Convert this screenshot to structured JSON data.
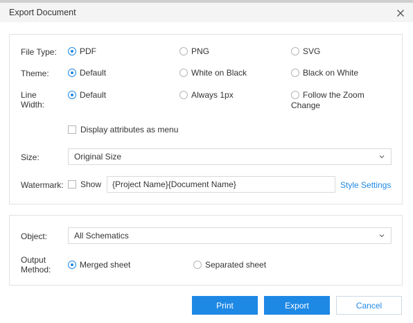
{
  "dialog": {
    "title": "Export Document"
  },
  "file_type": {
    "label": "File Type:",
    "options": [
      "PDF",
      "PNG",
      "SVG"
    ],
    "selected": "PDF"
  },
  "theme": {
    "label": "Theme:",
    "options": [
      "Default",
      "White on Black",
      "Black on White"
    ],
    "selected": "Default"
  },
  "line_width": {
    "label_line1": "Line",
    "label_line2": "Width:",
    "options": [
      "Default",
      "Always 1px"
    ],
    "option3_line1": "Follow the Zoom",
    "option3_line2": "Change",
    "selected": "Default"
  },
  "display_attrs": {
    "label": "Display attributes as menu",
    "checked": false
  },
  "size": {
    "label": "Size:",
    "value": "Original Size"
  },
  "watermark": {
    "label": "Watermark:",
    "show_label": "Show",
    "show_checked": false,
    "text_value": "{Project Name}{Document Name}",
    "style_link": "Style Settings"
  },
  "object": {
    "label": "Object:",
    "value": "All Schematics"
  },
  "output_method": {
    "label_line1": "Output",
    "label_line2": "Method:",
    "options": [
      "Merged sheet",
      "Separated sheet"
    ],
    "selected": "Merged sheet"
  },
  "buttons": {
    "print": "Print",
    "export": "Export",
    "cancel": "Cancel"
  },
  "colors": {
    "accent": "#1e88e5",
    "border": "#d9d9d9",
    "title_bg": "#f4f4f4"
  },
  "icons": {
    "close": "close-icon",
    "dropdown": "chevron-down-icon"
  }
}
